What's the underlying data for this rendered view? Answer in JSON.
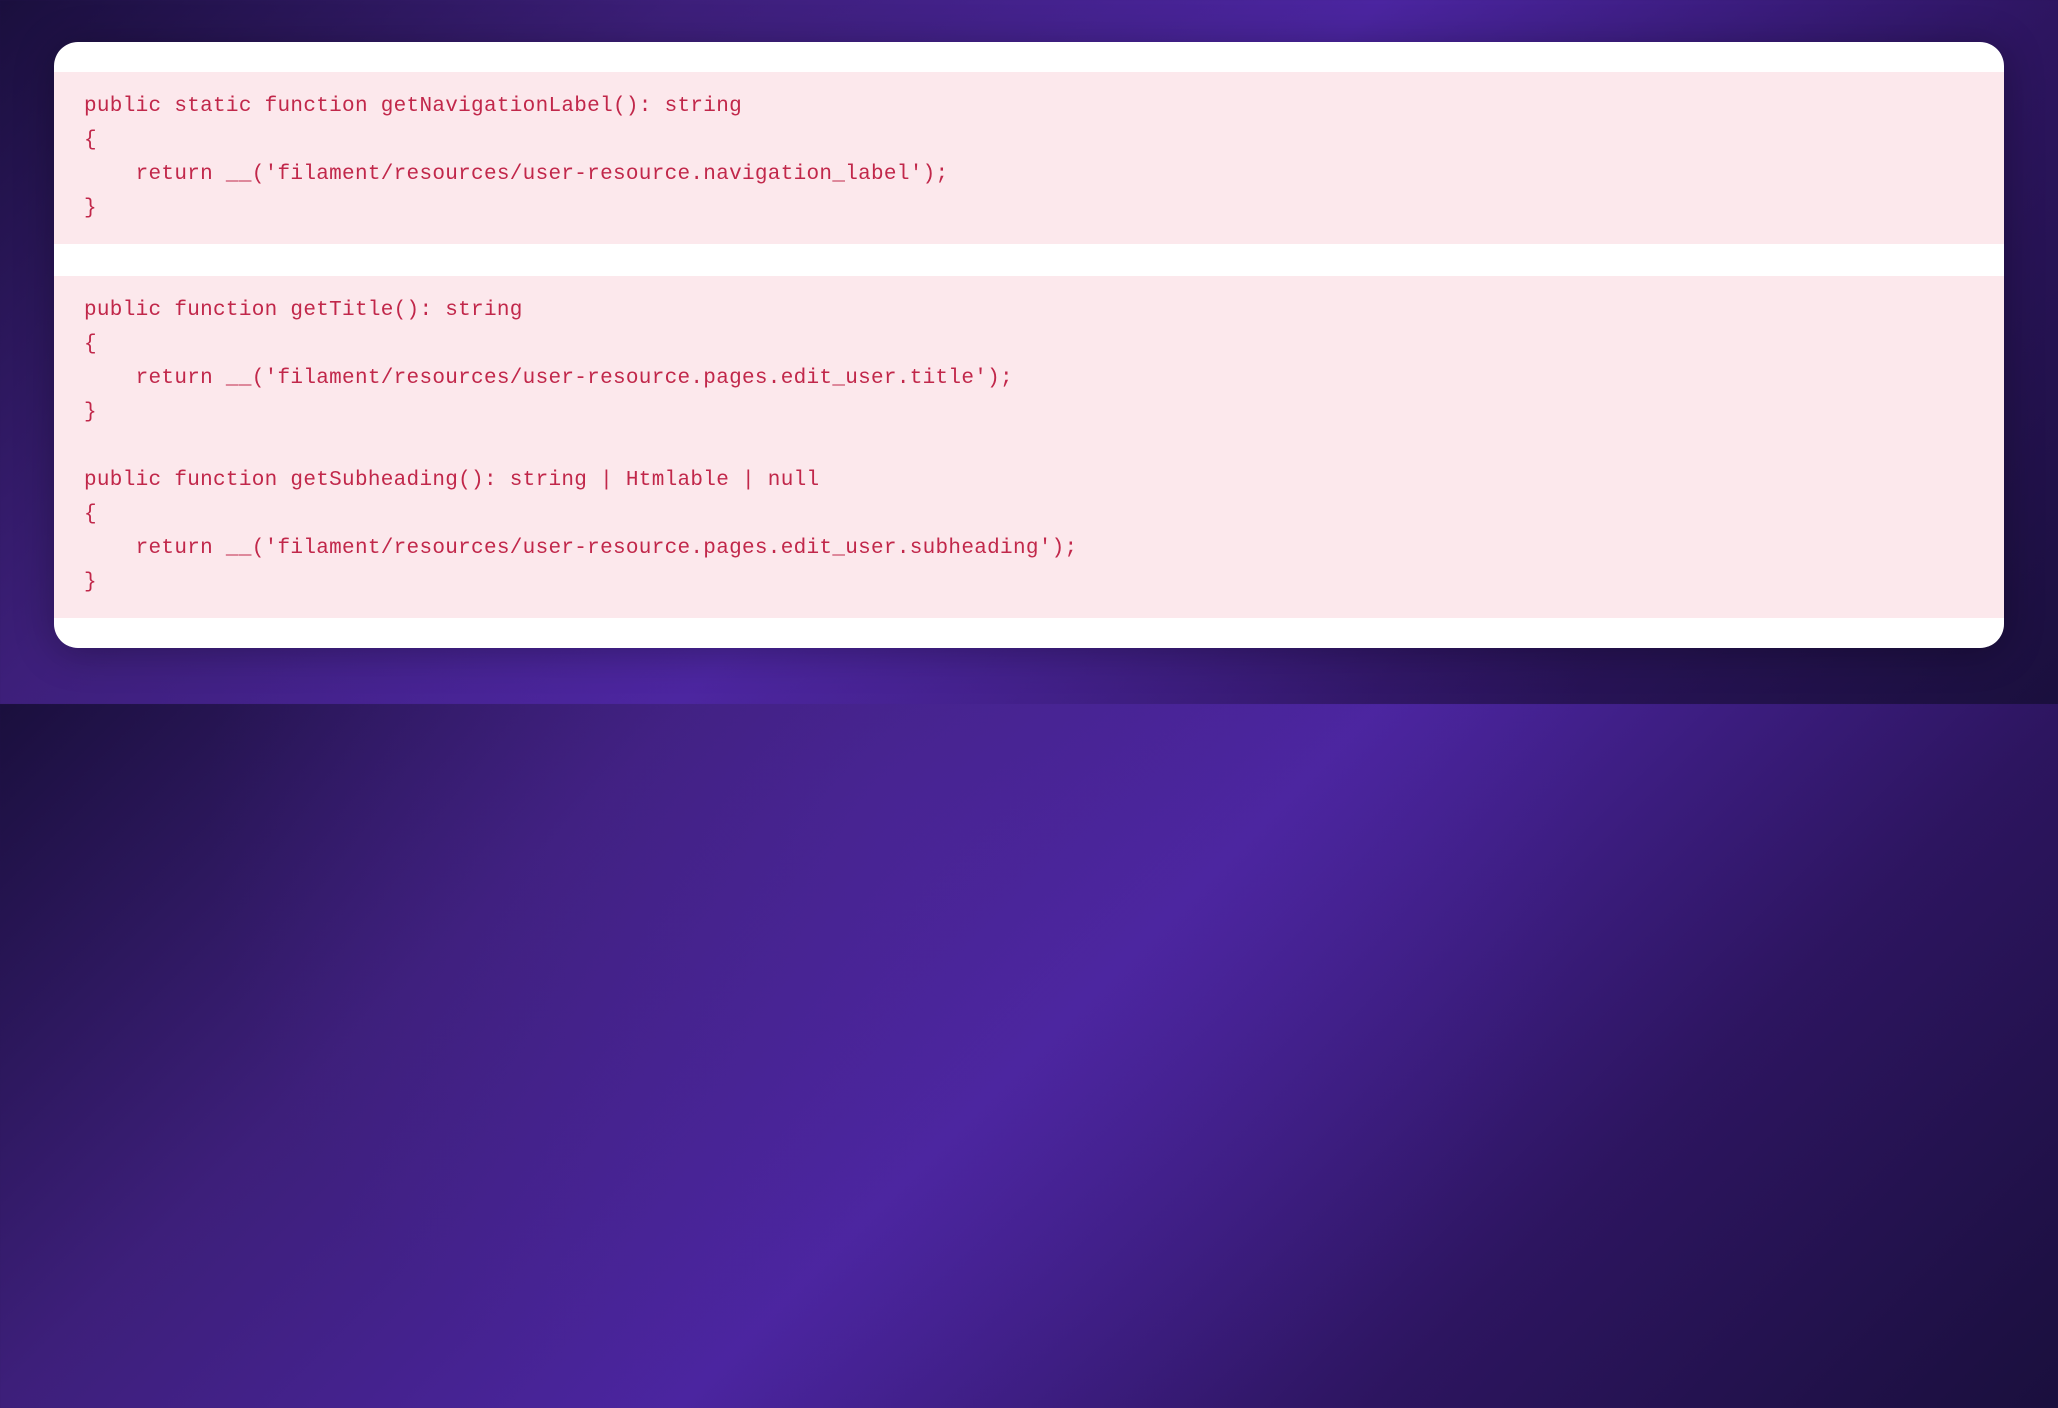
{
  "code_block_1": "public static function getNavigationLabel(): string\n{\n    return __('filament/resources/user-resource.navigation_label');\n}",
  "code_block_2": "public function getTitle(): string\n{\n    return __('filament/resources/user-resource.pages.edit_user.title');\n}\n\npublic function getSubheading(): string | Htmlable | null\n{\n    return __('filament/resources/user-resource.pages.edit_user.subheading');\n}"
}
